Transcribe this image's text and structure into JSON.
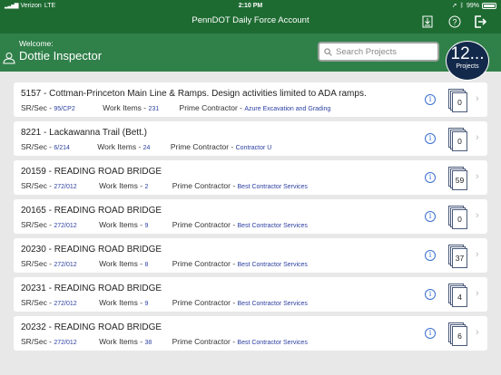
{
  "status": {
    "carrier": "Verizon",
    "network": "LTE",
    "time": "2:10 PM",
    "battery": "99%",
    "battery_level": 0.99
  },
  "nav": {
    "title": "PennDOT Daily Force Account"
  },
  "header": {
    "welcome": "Welcome:",
    "user": "Dottie Inspector",
    "search_placeholder": "Search Projects"
  },
  "badge": {
    "count": "12...",
    "label": "Projects"
  },
  "labels": {
    "srsec": "SR/Sec - ",
    "workitems": "Work Items - ",
    "prime": "Prime Contractor - "
  },
  "projects": [
    {
      "title": "5157 - Cottman-Princeton Main Line & Ramps.  Design activities limited to ADA ramps.",
      "srsec": "95/CP2",
      "work_items": "231",
      "contractor": "Azure Excavation and Grading",
      "docs": "0"
    },
    {
      "title": "8221 - Lackawanna Trail (Bett.)",
      "srsec": "6/214",
      "work_items": "24",
      "contractor": "Contractor U",
      "docs": "0"
    },
    {
      "title": "20159 - READING ROAD BRIDGE",
      "srsec": "272/012",
      "work_items": "2",
      "contractor": "Best Contractor Services",
      "docs": "59"
    },
    {
      "title": "20165 - READING ROAD BRIDGE",
      "srsec": "272/012",
      "work_items": "9",
      "contractor": "Best Contractor Services",
      "docs": "0"
    },
    {
      "title": "20230 - READING ROAD BRIDGE",
      "srsec": "272/012",
      "work_items": "8",
      "contractor": "Best Contractor Services",
      "docs": "37"
    },
    {
      "title": "20231 - READING ROAD BRIDGE",
      "srsec": "272/012",
      "work_items": "9",
      "contractor": "Best Contractor Services",
      "docs": "4"
    },
    {
      "title": "20232 - READING ROAD BRIDGE",
      "srsec": "272/012",
      "work_items": "38",
      "contractor": "Best Contractor Services",
      "docs": "6"
    }
  ],
  "colors": {
    "nav": "#1e6b32",
    "header": "#30804a",
    "badge": "#13294b",
    "link": "#2b3fa0"
  }
}
